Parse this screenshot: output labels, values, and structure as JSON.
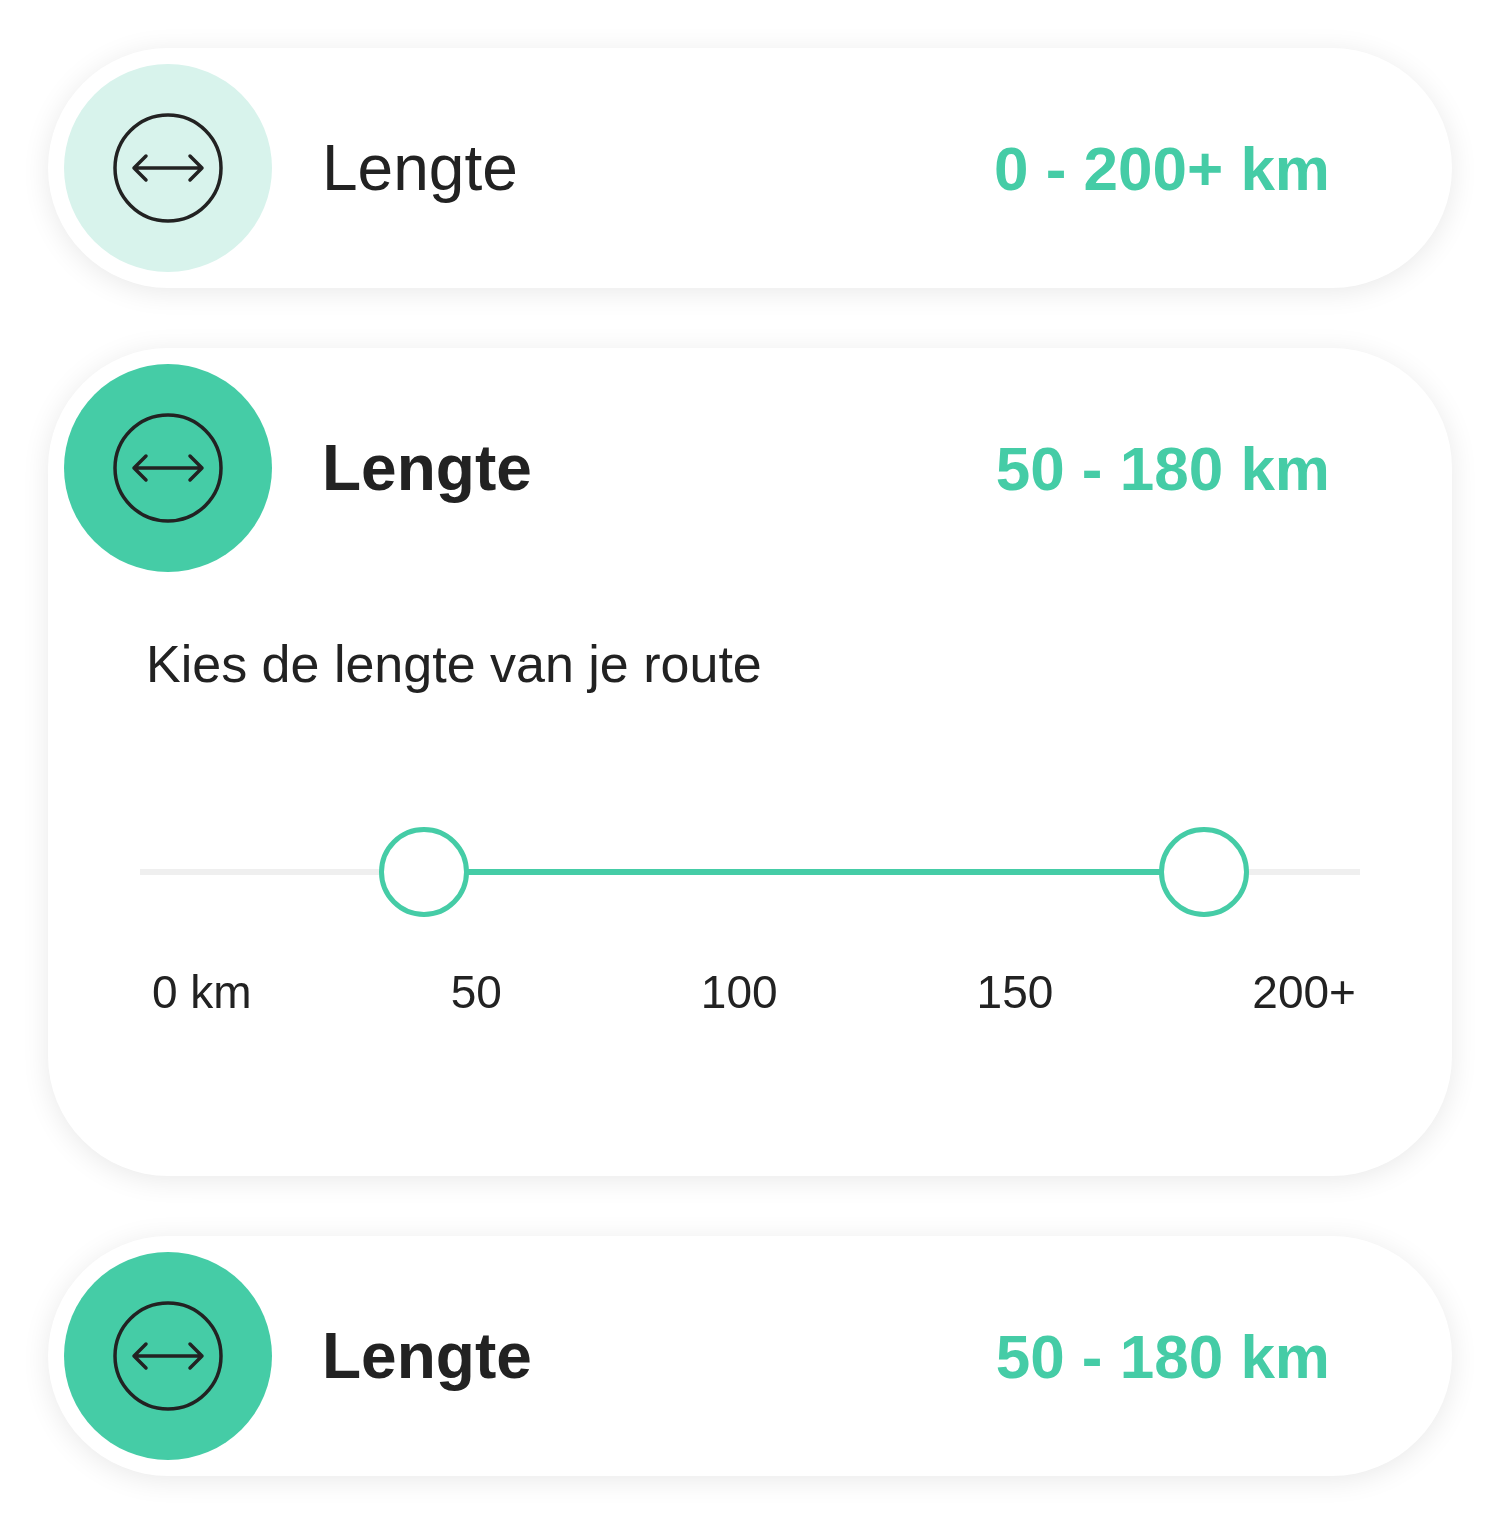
{
  "cards": [
    {
      "title": "Lengte",
      "value": "0 - 200+ km",
      "active": false,
      "expanded": false
    },
    {
      "title": "Lengte",
      "value": "50 - 180 km",
      "active": true,
      "expanded": true,
      "prompt": "Kies de lengte van je route",
      "slider": {
        "thumbs": [
          {
            "level": 0.233
          },
          {
            "level": 0.872
          }
        ]
      },
      "ticks": [
        "0 km",
        "50",
        "100",
        "150",
        "200+"
      ]
    },
    {
      "title": "Lengte",
      "value": "50 - 180 km",
      "active": true,
      "expanded": false
    }
  ]
}
